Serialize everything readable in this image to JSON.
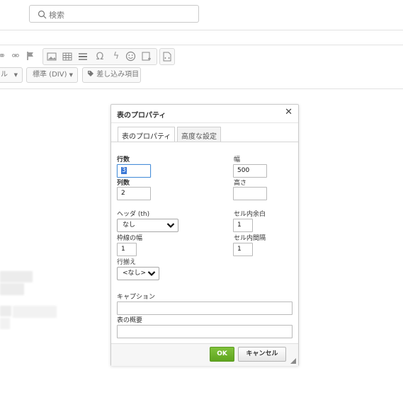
{
  "search": {
    "placeholder": "検索"
  },
  "toolbar": {
    "format_combo_partial": "ル",
    "style_combo": "標準 (DIV)",
    "insert_placeholder_button": "差し込み項目"
  },
  "dialog": {
    "title": "表のプロパティ",
    "tabs": [
      {
        "label": "表のプロパティ",
        "active": true
      },
      {
        "label": "高度な設定",
        "active": false
      }
    ],
    "fields": {
      "rows": {
        "label": "行数",
        "value": "3"
      },
      "width": {
        "label": "幅",
        "value": "500"
      },
      "columns": {
        "label": "列数",
        "value": "2"
      },
      "height": {
        "label": "高さ",
        "value": ""
      },
      "header": {
        "label": "ヘッダ (th)",
        "value": "なし"
      },
      "cell_padding": {
        "label": "セル内余白",
        "value": "1"
      },
      "border_width": {
        "label": "枠線の幅",
        "value": "1"
      },
      "cell_spacing": {
        "label": "セル内間隔",
        "value": "1"
      },
      "alignment": {
        "label": "行揃え",
        "value": "<なし>"
      },
      "caption": {
        "label": "キャプション",
        "value": ""
      },
      "summary": {
        "label": "表の概要",
        "value": ""
      }
    },
    "ok_label": "OK",
    "cancel_label": "キャンセル"
  }
}
